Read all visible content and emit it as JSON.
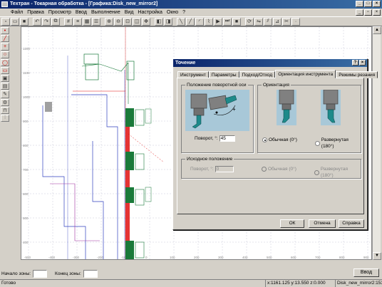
{
  "app": {
    "title": "Техтран - Токарная обработка - [Графика:Disk_new_mirror2]"
  },
  "menu": [
    "Файл",
    "Правка",
    "Просмотр",
    "Ввод",
    "Выполнение",
    "Вид",
    "Настройка",
    "Окно",
    "?"
  ],
  "canvas": {
    "y_ticks": [
      "1200",
      "1100",
      "1000",
      "900",
      "800",
      "700",
      "600",
      "500",
      "400",
      "300",
      "200"
    ],
    "x_ticks": [
      "-500",
      "-400",
      "-300",
      "-200",
      "-100",
      "0",
      "100",
      "200",
      "300",
      "400",
      "500",
      "600",
      "700",
      "800",
      "900"
    ]
  },
  "dialog": {
    "title": "Точение",
    "tabs": [
      "Инструмент",
      "Параметры",
      "Подход/Отход",
      "Ориентация инструмента",
      "Режимы резания"
    ],
    "active_tab": 3,
    "group_axis": {
      "label": "Положение поворотной оси",
      "rotation_label": "Поворот, °:",
      "rotation_value": "45"
    },
    "group_orient": {
      "label": "Ориентация",
      "option_normal": "Обычная (0°)",
      "option_reversed": "Развернутая (180°)",
      "selected": "normal"
    },
    "group_initial": {
      "label": "Исходное положение",
      "rotation_label": "Поворот, °:",
      "rotation_value": "0",
      "option_normal": "Обычная (0°)",
      "option_reversed": "Развернутая (180°)"
    },
    "buttons": {
      "ok": "ОК",
      "cancel": "Отмена",
      "help": "Справка"
    }
  },
  "bottom": {
    "zone_start_label": "Начало зоны:",
    "zone_end_label": "Конец зоны:",
    "enter_button": "Ввод"
  },
  "statusbar": {
    "status": "Готово",
    "coords": "x:1161.125 y:13.550 z:0.000",
    "doc": "Disk_new_mirror2:153"
  },
  "colors": {
    "title_bar": "#0a246a",
    "tool_green": "#1a7a3a",
    "cut_red": "#e01010",
    "contour_blue": "#3040c0",
    "illustration_bg": "#a8c8d8"
  }
}
